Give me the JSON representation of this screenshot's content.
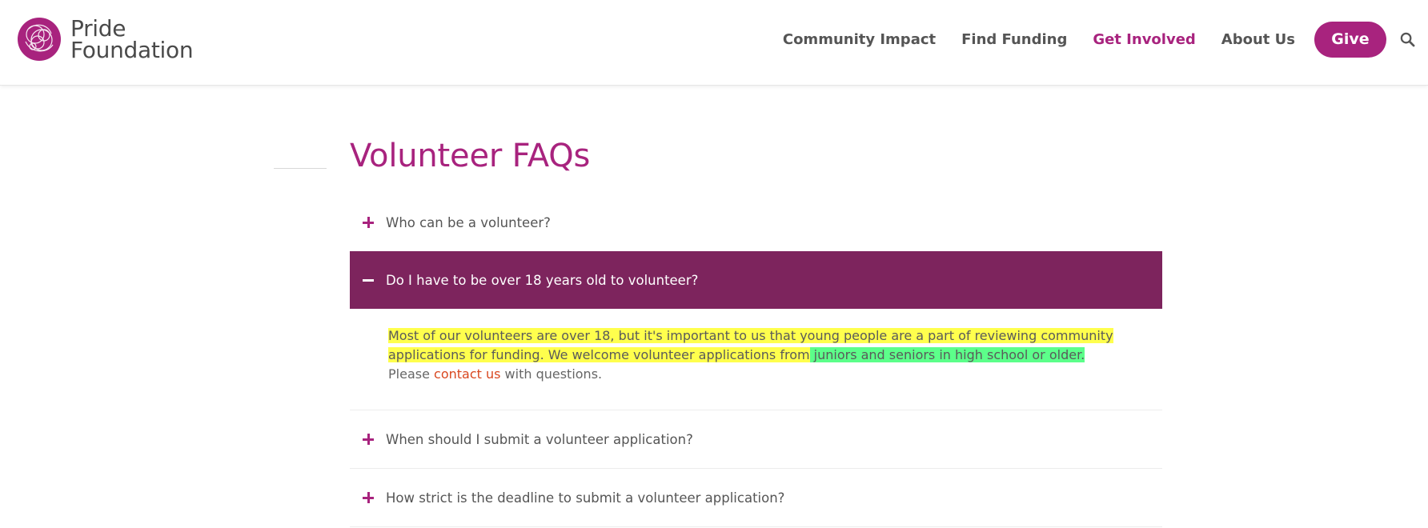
{
  "header": {
    "logo": {
      "line1": "Pride",
      "line2": "Foundation"
    },
    "nav": [
      {
        "label": "Community Impact",
        "active": false
      },
      {
        "label": "Find Funding",
        "active": false
      },
      {
        "label": "Get Involved",
        "active": true
      },
      {
        "label": "About Us",
        "active": false
      }
    ],
    "give_label": "Give",
    "search_icon": "search-icon"
  },
  "main": {
    "title": "Volunteer FAQs",
    "faqs": [
      {
        "question": "Who can be a volunteer?",
        "expanded": false
      },
      {
        "question": "Do I have to be over 18 years old to volunteer?",
        "expanded": true,
        "answer": {
          "highlight_yellow": "Most of our volunteers are over 18, but it's important to us that young people are a part of reviewing community applications for funding. We welcome volunteer applications from",
          "highlight_green": " juniors and seniors in high school or older.",
          "after_highlight": " Please ",
          "link_text": "contact us",
          "ending": " with questions."
        }
      },
      {
        "question": "When should I submit a volunteer application?",
        "expanded": false
      },
      {
        "question": "How strict is the deadline to submit a volunteer application?",
        "expanded": false
      }
    ]
  },
  "colors": {
    "brand": "#a8237e",
    "expanded_bg": "#7d245d",
    "link": "#d9471f",
    "highlight_yellow": "#ffff4d",
    "highlight_green": "#5cff8a"
  }
}
